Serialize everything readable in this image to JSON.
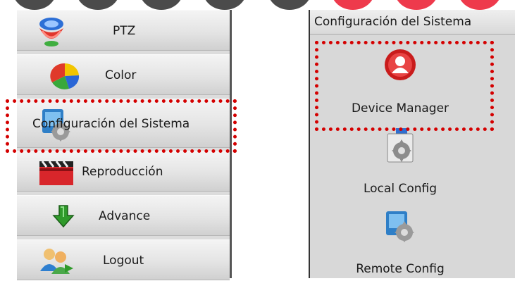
{
  "left_menu": {
    "items": [
      {
        "label": "PTZ",
        "icon": "ptz-icon"
      },
      {
        "label": "Color",
        "icon": "color-palette-icon"
      },
      {
        "label": "Configuración del Sistema",
        "icon": "system-config-icon"
      },
      {
        "label": "Reproducción",
        "icon": "clapperboard-icon"
      },
      {
        "label": "Advance",
        "icon": "green-arrow-down-icon"
      },
      {
        "label": "Logout",
        "icon": "users-logout-icon"
      }
    ]
  },
  "right_panel": {
    "header": "Configuración del Sistema",
    "items": [
      {
        "label": "Device Manager",
        "icon": "device-manager-icon"
      },
      {
        "label": "Local Config",
        "icon": "local-config-icon"
      },
      {
        "label": "Remote Config",
        "icon": "remote-config-icon"
      }
    ]
  },
  "colors": {
    "highlight": "#d40000",
    "logo_red": "#ee3a4c",
    "logo_gray": "#4b4b4b"
  }
}
